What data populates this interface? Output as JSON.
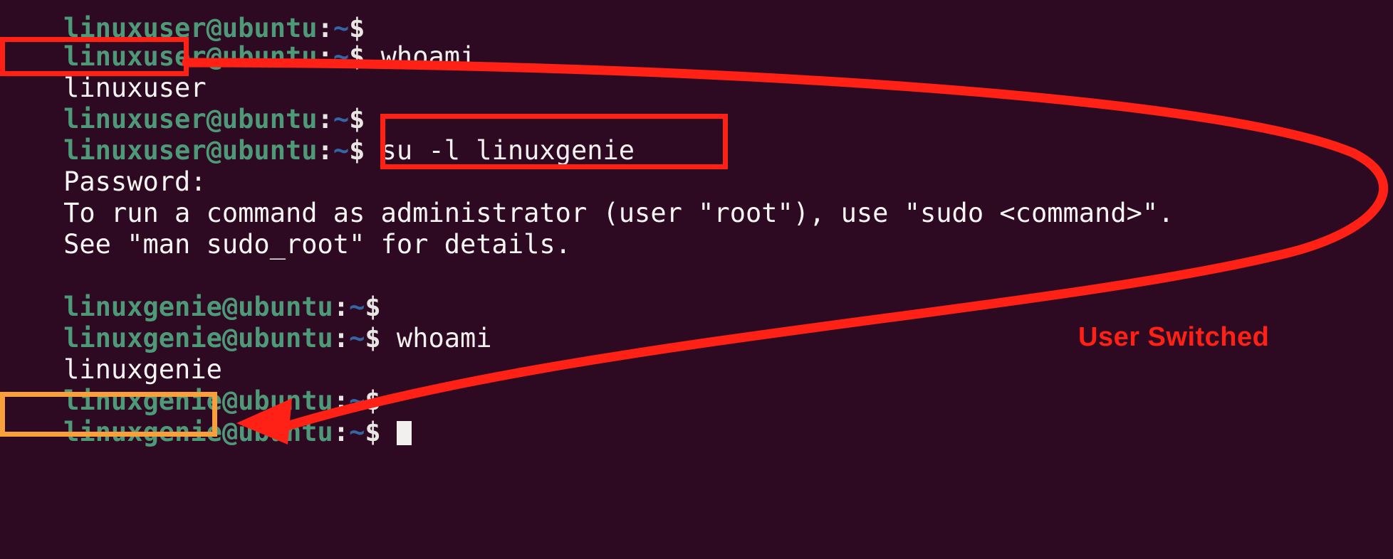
{
  "terminal": {
    "background_color": "#2d0a22",
    "prompt_user_color": "#4e9a78",
    "prompt_tilde_color": "#3465a4",
    "text_color": "#f2f0ee",
    "lines": [
      {
        "id": "line0-partial",
        "prompt_user": "linuxuser@ubuntu",
        "prompt_sep": ":",
        "prompt_tilde": "~",
        "prompt_dollar": "$",
        "command": ""
      },
      {
        "id": "line1",
        "prompt_user": "linuxuser@ubuntu",
        "prompt_sep": ":",
        "prompt_tilde": "~",
        "prompt_dollar": "$",
        "command": " whoami"
      },
      {
        "id": "line2-output",
        "output": "linuxuser"
      },
      {
        "id": "line3",
        "prompt_user": "linuxuser@ubuntu",
        "prompt_sep": ":",
        "prompt_tilde": "~",
        "prompt_dollar": "$",
        "command": ""
      },
      {
        "id": "line4",
        "prompt_user": "linuxuser@ubuntu",
        "prompt_sep": ":",
        "prompt_tilde": "~",
        "prompt_dollar": "$",
        "command": " su -l linuxgenie"
      },
      {
        "id": "line5-output",
        "output": "Password:"
      },
      {
        "id": "line6-output",
        "output": "To run a command as administrator (user \"root\"), use \"sudo <command>\"."
      },
      {
        "id": "line7-output",
        "output": "See \"man sudo_root\" for details."
      },
      {
        "id": "line8-blank",
        "output": ""
      },
      {
        "id": "line9",
        "prompt_user": "linuxgenie@ubuntu",
        "prompt_sep": ":",
        "prompt_tilde": "~",
        "prompt_dollar": "$",
        "command": ""
      },
      {
        "id": "line10",
        "prompt_user": "linuxgenie@ubuntu",
        "prompt_sep": ":",
        "prompt_tilde": "~",
        "prompt_dollar": "$",
        "command": " whoami"
      },
      {
        "id": "line11-output",
        "output": "linuxgenie"
      },
      {
        "id": "line12",
        "prompt_user": "linuxgenie@ubuntu",
        "prompt_sep": ":",
        "prompt_tilde": "~",
        "prompt_dollar": "$",
        "command": ""
      },
      {
        "id": "line13",
        "prompt_user": "linuxgenie@ubuntu",
        "prompt_sep": ":",
        "prompt_tilde": "~",
        "prompt_dollar": "$",
        "command": ""
      }
    ]
  },
  "annotations": {
    "highlight_linuxuser": {
      "color": "#ff2016",
      "label": "linuxuser"
    },
    "highlight_su_command": {
      "color": "#ff2016",
      "label": "su -l linuxgenie"
    },
    "highlight_linuxgenie": {
      "color": "#f9a03c",
      "label": "linuxgenie"
    },
    "callout_text": "User Switched",
    "callout_color": "#ff2016",
    "arrow_color": "#ff2016"
  }
}
